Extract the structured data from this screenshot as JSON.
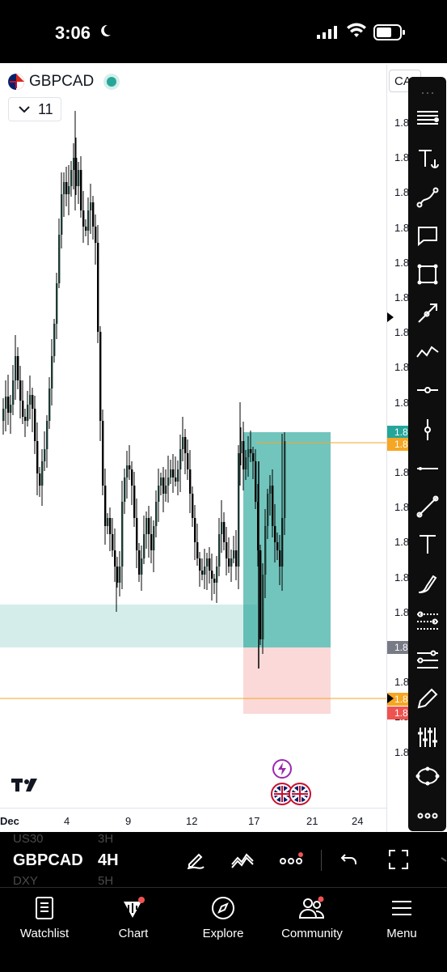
{
  "status": {
    "time": "3:06"
  },
  "symbol_header": {
    "symbol": "GBPCAD",
    "interval_chip": "11"
  },
  "price_axis": {
    "currency_chip": "CAD",
    "tick_labels": [
      "1.8",
      "1.8",
      "1.8",
      "1.8",
      "1.8",
      "1.8",
      "1.8",
      "1.8",
      "1.8",
      "1.8",
      "1.8",
      "1.8",
      "1.8",
      "1.8",
      "1.8",
      "1.8",
      "1.8",
      "1.8",
      "1.8"
    ],
    "price_labels": [
      {
        "text": "1.8",
        "color": "#26a69a"
      },
      {
        "text": "1.8",
        "color": "#f5a623"
      },
      {
        "text": "1.8",
        "color": "#787b86"
      },
      {
        "text": "1.8",
        "color": "#f5a623"
      },
      {
        "text": "1.8",
        "color": "#ef5350"
      }
    ]
  },
  "time_axis": {
    "labels": [
      "Dec",
      "4",
      "9",
      "12",
      "17",
      "21",
      "24"
    ]
  },
  "toolbar": {
    "items": [
      "drag-handle-icon",
      "horizontal-lines-icon",
      "anchored-text-icon",
      "path-icon",
      "callout-icon",
      "rectangle-icon",
      "arrow-icon",
      "zigzag-icon",
      "horizontal-ray-icon",
      "vertical-line-icon",
      "horizontal-line-icon",
      "trend-line-icon",
      "text-icon",
      "brush-icon",
      "parallel-channel-icon",
      "regression-icon",
      "highlighter-icon",
      "sliders-icon",
      "ellipse-icon",
      "more-icon"
    ]
  },
  "bottom_bar": {
    "symbol": "GBPCAD",
    "interval": "4H",
    "ghost_above": "US30",
    "ghost_above_int": "3H",
    "ghost_below": "DXY",
    "ghost_below_int": "5H"
  },
  "tabs": [
    {
      "label": "Watchlist"
    },
    {
      "label": "Chart"
    },
    {
      "label": "Explore"
    },
    {
      "label": "Community"
    },
    {
      "label": "Menu"
    }
  ],
  "colors": {
    "up": "#26a69a",
    "down": "#000000",
    "target": "#26a69a",
    "stop": "#ef9a9a",
    "accent": "#f5a623"
  }
}
